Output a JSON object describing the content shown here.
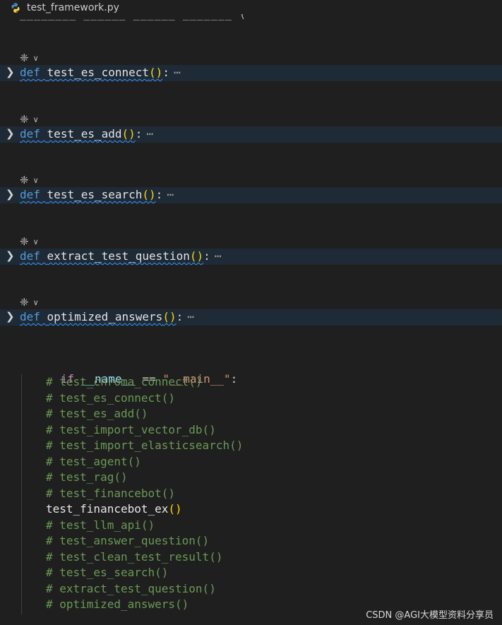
{
  "tab": {
    "filename": "test_framework.py",
    "icon": "python-file-icon"
  },
  "folded_functions": [
    {
      "hint_icon": "sparkle-icon",
      "keyword": "def",
      "name": "test_es_connect",
      "parens": "()",
      "colon": ":",
      "ellipsis": "⋯"
    },
    {
      "hint_icon": "sparkle-icon",
      "keyword": "def",
      "name": "test_es_add",
      "parens": "()",
      "colon": ":",
      "ellipsis": "⋯"
    },
    {
      "hint_icon": "sparkle-icon",
      "keyword": "def",
      "name": "test_es_search",
      "parens": "()",
      "colon": ":",
      "ellipsis": "⋯"
    },
    {
      "hint_icon": "sparkle-icon",
      "keyword": "def",
      "name": "extract_test_question",
      "parens": "()",
      "colon": ":",
      "ellipsis": "⋯"
    },
    {
      "hint_icon": "sparkle-icon",
      "keyword": "def",
      "name": "optimized_answers",
      "parens": "()",
      "colon": ":",
      "ellipsis": "⋯"
    }
  ],
  "main_block": {
    "kw_if": "if",
    "dunder_name": "__name__",
    "op_eq": "==",
    "str_main": "\"__main__\"",
    "colon": ":",
    "lines": [
      {
        "text": "# test_chroma_connect()",
        "kind": "comment"
      },
      {
        "text": "# test_es_connect()",
        "kind": "comment"
      },
      {
        "text": "# test_es_add()",
        "kind": "comment"
      },
      {
        "text": "# test_import_vector_db()",
        "kind": "comment"
      },
      {
        "text": "# test_import_elasticsearch()",
        "kind": "comment"
      },
      {
        "text": "# test_agent()",
        "kind": "comment"
      },
      {
        "text": "# test_rag()",
        "kind": "comment"
      },
      {
        "text": "# test_financebot()",
        "kind": "comment"
      },
      {
        "text": "test_financebot_ex",
        "kind": "call",
        "parens": "()"
      },
      {
        "text": "# test_llm_api()",
        "kind": "comment"
      },
      {
        "text": "# test_answer_question()",
        "kind": "comment"
      },
      {
        "text": "# test_clean_test_result()",
        "kind": "comment"
      },
      {
        "text": "# test_es_search()",
        "kind": "comment"
      },
      {
        "text": "# extract_test_question()",
        "kind": "comment"
      },
      {
        "text": "# optimized_answers()",
        "kind": "comment"
      }
    ]
  },
  "watermark": "CSDN @AGI大模型资料分享员",
  "colors": {
    "background": "#1f1f1f",
    "fold_highlight": "#1e2a36",
    "keyword_def": "#569cd6",
    "keyword_if": "#c586c0",
    "comment": "#6a9955",
    "string": "#ce9178",
    "paren": "#ffd700"
  }
}
